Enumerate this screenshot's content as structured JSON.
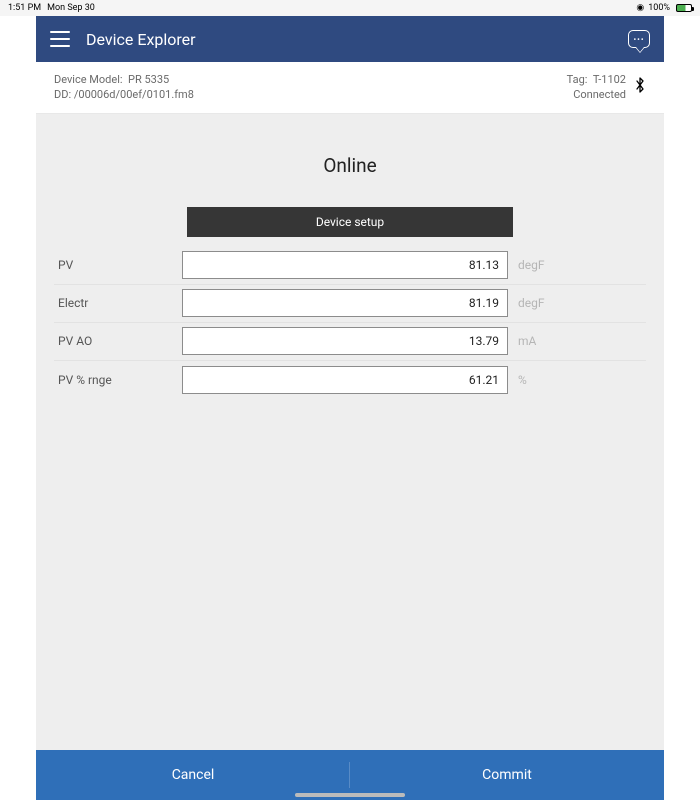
{
  "statusBar": {
    "time": "1:51 PM",
    "date": "Mon Sep 30",
    "battery": "100%"
  },
  "header": {
    "title": "Device Explorer"
  },
  "deviceInfo": {
    "modelLabel": "Device Model:",
    "modelValue": "PR 5335",
    "ddLabel": "DD:",
    "ddValue": "/00006d/00ef/0101.fm8",
    "tagLabel": "Tag:",
    "tagValue": "T-1102",
    "connStatus": "Connected"
  },
  "page": {
    "title": "Online",
    "setupButton": "Device setup"
  },
  "rows": [
    {
      "label": "PV",
      "value": "81.13",
      "unit": "degF"
    },
    {
      "label": "Electr",
      "value": "81.19",
      "unit": "degF"
    },
    {
      "label": "PV AO",
      "value": "13.79",
      "unit": "mA"
    },
    {
      "label": "PV % rnge",
      "value": "61.21",
      "unit": "%"
    }
  ],
  "footer": {
    "cancel": "Cancel",
    "commit": "Commit"
  }
}
